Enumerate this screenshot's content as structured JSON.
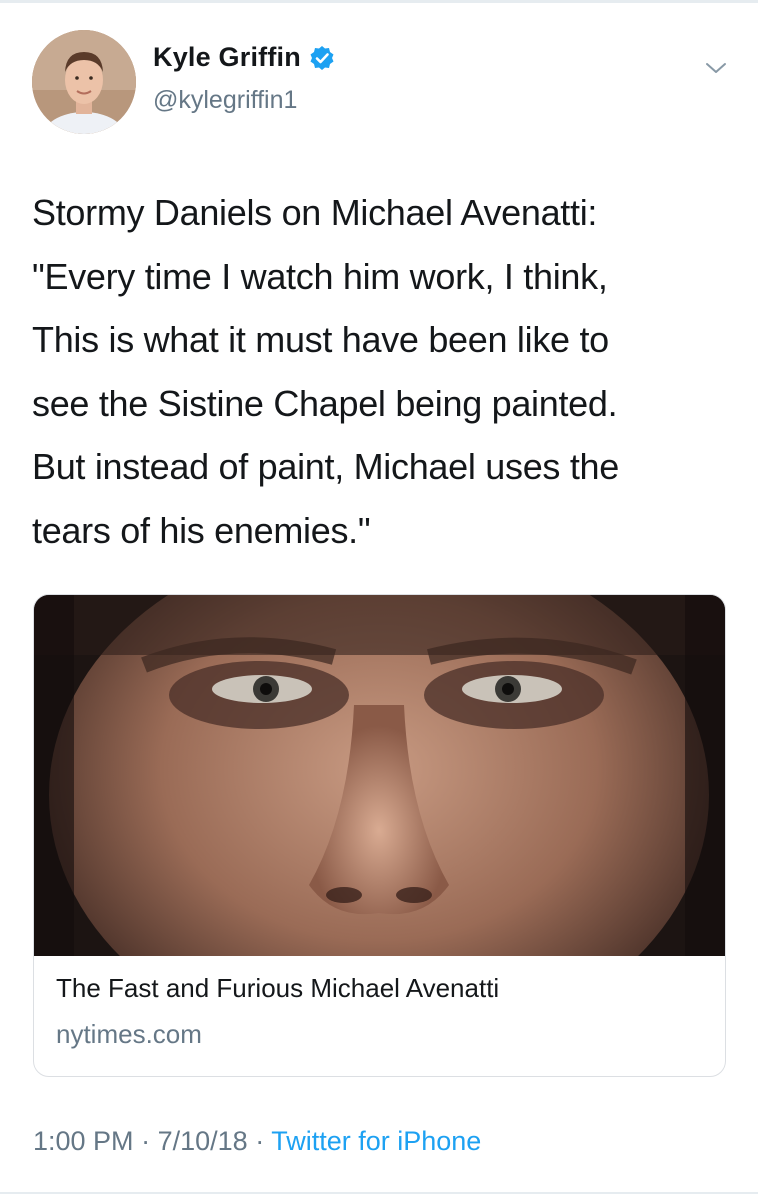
{
  "author": {
    "display_name": "Kyle Griffin",
    "handle": "@kylegriffin1",
    "verified": true
  },
  "tweet": {
    "lines": [
      "Stormy Daniels on Michael Avenatti:",
      "\"Every time I watch him work, I think,",
      "This is what it must have been like to",
      "see the Sistine Chapel being painted.",
      "But instead of paint, Michael uses the",
      "tears of his enemies.\""
    ]
  },
  "card": {
    "title": "The Fast and Furious Michael Avenatti",
    "domain": "nytimes.com"
  },
  "meta": {
    "time": "1:00 PM",
    "date": "7/10/18",
    "separator": "·",
    "source": "Twitter for iPhone"
  },
  "colors": {
    "text": "#14171a",
    "secondary": "#657786",
    "accent": "#1da1f2",
    "border": "#e6ecf0"
  },
  "icons": {
    "verified": "verified-badge-icon",
    "more": "chevron-down-icon"
  }
}
